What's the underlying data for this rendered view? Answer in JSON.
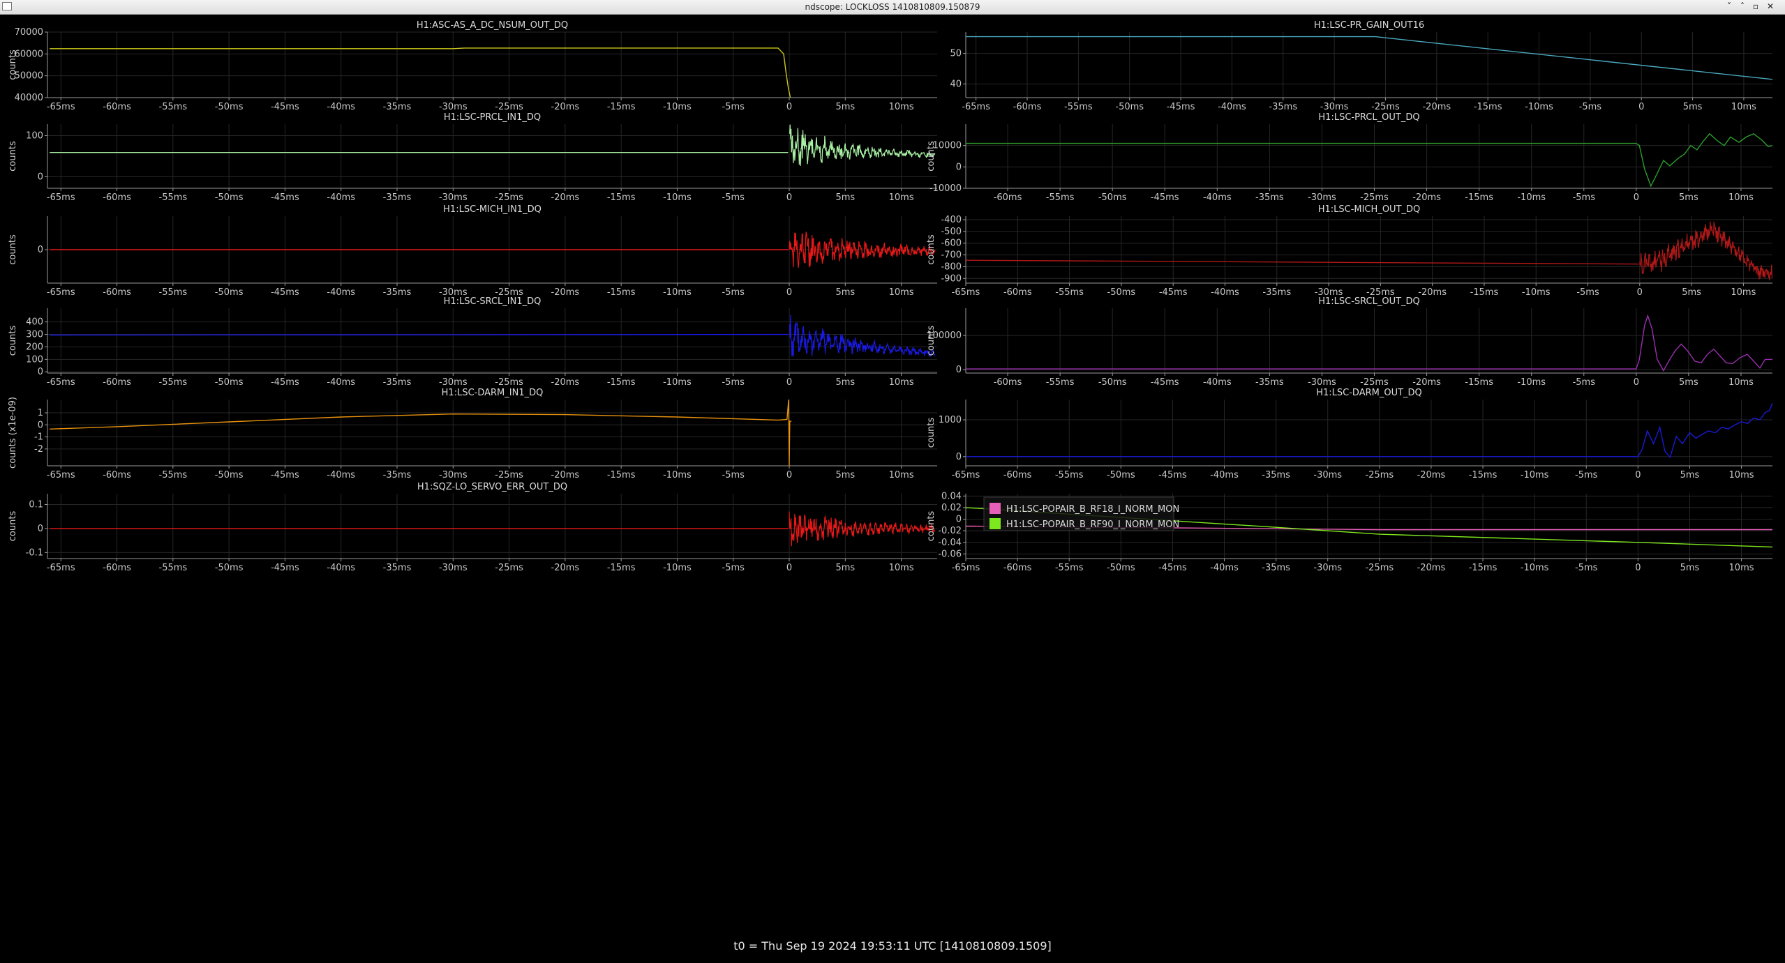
{
  "window": {
    "title": "ndscope: LOCKLOSS 1410810809.150879",
    "minimize_glyph": "˅",
    "maximize_glyph": "˄",
    "restore_glyph": "▫",
    "close_glyph": "✕"
  },
  "footer": "t0 = Thu Sep 19 2024 19:53:11 UTC [1410810809.1509]",
  "x_tick_labels": [
    "-65ms",
    "-60ms",
    "-55ms",
    "-50ms",
    "-45ms",
    "-40ms",
    "-35ms",
    "-30ms",
    "-25ms",
    "-20ms",
    "-15ms",
    "-10ms",
    "-5ms",
    "0",
    "5ms",
    "10ms"
  ],
  "chart_data": [
    {
      "type": "line",
      "title": "H1:ASC-AS_A_DC_NSUM_OUT_DQ",
      "ylabel": "counts",
      "xlim": [
        -66.2,
        13.2
      ],
      "ylim": [
        40000,
        70000
      ],
      "yticks": [
        40000,
        50000,
        60000,
        70000
      ],
      "color": "#ccc818",
      "series": [
        {
          "x": [
            -66,
            -30,
            -29,
            -15,
            -1,
            -0.5,
            -0.3,
            -0.1,
            0.1
          ],
          "y": [
            62400,
            62400,
            62700,
            62700,
            62700,
            60000,
            52000,
            45000,
            40000
          ]
        }
      ]
    },
    {
      "type": "line",
      "title": "H1:LSC-PR_GAIN_OUT16",
      "ylabel": "",
      "xlim": [
        -66,
        12.8
      ],
      "ylim": [
        35.5,
        57
      ],
      "yticks": [
        40,
        50
      ],
      "color": "#4aa8be",
      "series": [
        {
          "x": [
            -66,
            -26,
            12.8
          ],
          "y": [
            55.5,
            55.5,
            41.5
          ]
        }
      ]
    },
    {
      "type": "line",
      "title": "H1:LSC-PRCL_IN1_DQ",
      "ylabel": "counts",
      "xlim": [
        -66.2,
        13.2
      ],
      "ylim": [
        -28,
        128
      ],
      "yticks": [
        0,
        100
      ],
      "color": "#a8f0a4",
      "series": [
        {
          "x": [
            -66,
            -0.1
          ],
          "y": [
            59,
            59
          ]
        }
      ],
      "burst": {
        "t0": 0,
        "t1": 13,
        "center": [
          70,
          53
        ],
        "amp": [
          60,
          2
        ],
        "period": 0.62,
        "noise": 0.5,
        "seed": 3
      }
    },
    {
      "type": "line",
      "title": "H1:LSC-PRCL_OUT_DQ",
      "ylabel": "counts",
      "xlim": [
        -64,
        13
      ],
      "ylim": [
        -10000,
        20000
      ],
      "yticks": [
        -10000,
        0,
        10000
      ],
      "color": "#2c9e2c",
      "series": [
        {
          "x": [
            -64,
            0,
            0.3,
            0.8,
            1.4,
            2,
            2.6,
            3.2,
            4,
            4.6,
            5.2,
            5.8,
            6.4,
            7,
            7.8,
            8.4,
            9,
            9.8,
            10.5,
            11.2,
            12,
            12.6,
            13
          ],
          "y": [
            11000,
            11000,
            10000,
            -1000,
            -9000,
            -3000,
            3000,
            500,
            4000,
            6000,
            10000,
            8000,
            12000,
            15500,
            12000,
            10000,
            14000,
            11500,
            14000,
            15500,
            12500,
            9500,
            10000
          ]
        }
      ]
    },
    {
      "type": "line",
      "title": "H1:LSC-MICH_IN1_DQ",
      "ylabel": "counts",
      "xlim": [
        -66.2,
        13.2
      ],
      "ylim": [
        -120,
        120
      ],
      "yticks": [
        0
      ],
      "color": "#e81818",
      "series": [
        {
          "x": [
            -66,
            -0.1
          ],
          "y": [
            0,
            0
          ]
        }
      ],
      "burst": {
        "t0": 0,
        "t1": 13,
        "center": [
          5,
          -5
        ],
        "amp": [
          80,
          15
        ],
        "period": 0.52,
        "noise": 0.55,
        "seed": 7
      }
    },
    {
      "type": "line",
      "title": "H1:LSC-MICH_OUT_DQ",
      "ylabel": "counts",
      "xlim": [
        -65,
        12.8
      ],
      "ylim": [
        -940,
        -370
      ],
      "yticks": [
        -900,
        -800,
        -700,
        -600,
        -500,
        -400
      ],
      "color": "#b01818",
      "series": [
        {
          "x": [
            -65,
            -0.1
          ],
          "y": [
            -745,
            -778
          ]
        }
      ],
      "burst": {
        "t0": 0,
        "t1": 12.8,
        "center": [
          -700,
          -800
        ],
        "amp": [
          70,
          70
        ],
        "period": 0.45,
        "noise": 0.6,
        "seed": 11,
        "hump": [
          0.1,
          0.9,
          -780,
          -480,
          -850
        ]
      }
    },
    {
      "type": "line",
      "title": "H1:LSC-SRCL_IN1_DQ",
      "ylabel": "counts",
      "xlim": [
        -66.2,
        13.2
      ],
      "ylim": [
        -10,
        510
      ],
      "yticks": [
        0,
        100,
        200,
        300,
        400
      ],
      "color": "#1a1ae8",
      "series": [
        {
          "x": [
            -66,
            -0.1
          ],
          "y": [
            295,
            300
          ]
        }
      ],
      "burst": {
        "t0": 0,
        "t1": 13,
        "center": [
          270,
          145
        ],
        "amp": [
          180,
          15
        ],
        "period": 0.58,
        "noise": 0.5,
        "seed": 5
      }
    },
    {
      "type": "line",
      "title": "H1:LSC-SRCL_OUT_DQ",
      "ylabel": "counts",
      "xlim": [
        -64,
        13
      ],
      "ylim": [
        -10000,
        180000
      ],
      "yticks": [
        0,
        100000
      ],
      "color": "#9a2fae",
      "series": [
        {
          "x": [
            -64,
            0,
            0.3,
            0.8,
            1.1,
            1.5,
            2,
            2.6,
            3.1,
            3.7,
            4.3,
            4.9,
            5.6,
            6.2,
            6.8,
            7.4,
            8,
            8.6,
            9.2,
            9.9,
            10.6,
            11.2,
            11.8,
            12.3,
            13
          ],
          "y": [
            2000,
            2000,
            30000,
            130000,
            158000,
            120000,
            30000,
            -3000,
            25000,
            55000,
            75000,
            55000,
            25000,
            20000,
            45000,
            60000,
            40000,
            20000,
            18000,
            35000,
            45000,
            25000,
            5000,
            30000,
            30000
          ]
        }
      ]
    },
    {
      "type": "line",
      "title": "H1:LSC-DARM_IN1_DQ",
      "ylabel": "counts (x1e-09)",
      "xlim": [
        -66.2,
        13.2
      ],
      "ylim": [
        -3.4,
        2.1
      ],
      "yticks": [
        -2,
        -1,
        0,
        1
      ],
      "color": "#e8920e",
      "series": [
        {
          "x": [
            -66,
            -60,
            -50,
            -40,
            -30,
            -20,
            -10,
            -1,
            -0.2,
            -0.05,
            0,
            0.05,
            0.2
          ],
          "y": [
            -0.35,
            -0.15,
            0.25,
            0.65,
            0.9,
            0.85,
            0.65,
            0.4,
            0.45,
            2.1,
            -3.4,
            0.3,
            0.3
          ]
        }
      ]
    },
    {
      "type": "line",
      "title": "H1:LSC-DARM_OUT_DQ",
      "ylabel": "counts",
      "xlim": [
        -65,
        13
      ],
      "ylim": [
        -250,
        1550
      ],
      "yticks": [
        0,
        1000
      ],
      "color": "#1a1ad6",
      "series": [
        {
          "x": [
            -65,
            0,
            0.4,
            0.9,
            1.5,
            2.1,
            2.6,
            3.1,
            3.7,
            4.3,
            5,
            5.6,
            6.2,
            6.8,
            7.5,
            8.1,
            8.7,
            9.3,
            10,
            10.6,
            11.2,
            11.8,
            12.3,
            12.7,
            13
          ],
          "y": [
            0,
            0,
            200,
            700,
            350,
            800,
            150,
            -20,
            550,
            350,
            650,
            500,
            600,
            700,
            650,
            800,
            750,
            850,
            950,
            900,
            1050,
            1000,
            1200,
            1250,
            1450
          ]
        }
      ]
    },
    {
      "type": "line",
      "title": "H1:SQZ-LO_SERVO_ERR_OUT_DQ",
      "ylabel": "counts",
      "xlim": [
        -66.2,
        13.2
      ],
      "ylim": [
        -0.125,
        0.145
      ],
      "yticks": [
        -0.1,
        0,
        0.1
      ],
      "color": "#e81818",
      "series": [
        {
          "x": [
            -66,
            -0.1
          ],
          "y": [
            0,
            0
          ]
        }
      ],
      "burst": {
        "t0": 0,
        "t1": 13,
        "center": [
          0,
          0
        ],
        "amp": [
          0.075,
          0.015
        ],
        "period": 0.45,
        "noise": 0.55,
        "seed": 13
      }
    },
    {
      "type": "line",
      "title": "",
      "ylabel": "counts",
      "xlim": [
        -65,
        13
      ],
      "ylim": [
        -0.068,
        0.044
      ],
      "yticks": [
        -0.06,
        -0.04,
        -0.02,
        0,
        0.02,
        0.04
      ],
      "series": [
        {
          "name": "H1:LSC-POPAIR_B_RF18_I_NORM_MON",
          "color": "#e85fb8",
          "x": [
            -65,
            -25,
            0,
            13
          ],
          "y": [
            -0.012,
            -0.018,
            -0.018,
            -0.018
          ]
        },
        {
          "name": "H1:LSC-POPAIR_B_RF90_I_NORM_MON",
          "color": "#7ee81e",
          "x": [
            -65,
            -35,
            -25,
            0,
            13
          ],
          "y": [
            0.02,
            -0.014,
            -0.026,
            -0.04,
            -0.048
          ]
        }
      ],
      "legend_position": "top-left"
    }
  ]
}
